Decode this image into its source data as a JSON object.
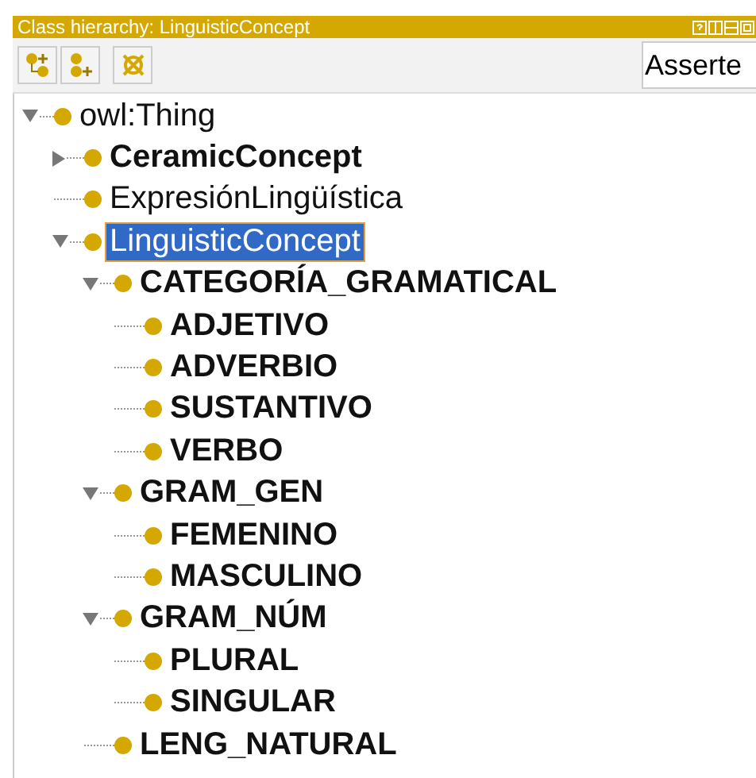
{
  "window": {
    "title": "Class hierarchy: LinguisticConcept"
  },
  "toolbar": {
    "view_selector": {
      "value": "Asserte"
    }
  },
  "tree": [
    {
      "label": "owl:Thing",
      "bold": false,
      "selected": false,
      "expanded": true,
      "children": [
        {
          "label": "CeramicConcept",
          "bold": true,
          "selected": false,
          "expanded": false
        },
        {
          "label": "ExpresiónLingüística",
          "bold": false,
          "selected": false
        },
        {
          "label": "LinguisticConcept",
          "bold": false,
          "selected": true,
          "expanded": true,
          "children": [
            {
              "label": "CATEGORÍA_GRAMATICAL",
              "bold": true,
              "selected": false,
              "expanded": true,
              "children": [
                {
                  "label": "ADJETIVO",
                  "bold": true,
                  "selected": false
                },
                {
                  "label": "ADVERBIO",
                  "bold": true,
                  "selected": false
                },
                {
                  "label": "SUSTANTIVO",
                  "bold": true,
                  "selected": false
                },
                {
                  "label": "VERBO",
                  "bold": true,
                  "selected": false
                }
              ]
            },
            {
              "label": "GRAM_GEN",
              "bold": true,
              "selected": false,
              "expanded": true,
              "children": [
                {
                  "label": "FEMENINO",
                  "bold": true,
                  "selected": false
                },
                {
                  "label": "MASCULINO",
                  "bold": true,
                  "selected": false
                }
              ]
            },
            {
              "label": "GRAM_NÚM",
              "bold": true,
              "selected": false,
              "expanded": true,
              "children": [
                {
                  "label": "PLURAL",
                  "bold": true,
                  "selected": false
                },
                {
                  "label": "SINGULAR",
                  "bold": true,
                  "selected": false
                }
              ]
            },
            {
              "label": "LENG_NATURAL",
              "bold": true,
              "selected": false
            }
          ]
        }
      ]
    }
  ]
}
